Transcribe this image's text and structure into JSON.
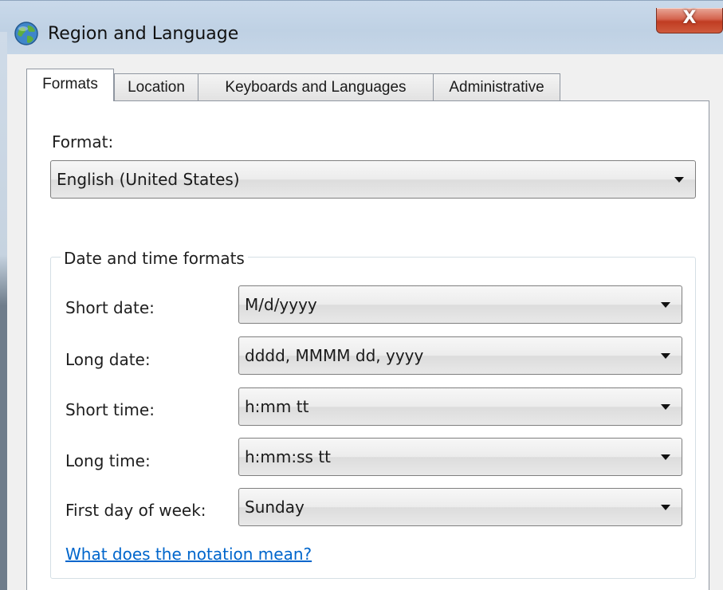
{
  "window": {
    "title": "Region and Language",
    "close_glyph": "X"
  },
  "tabs": [
    {
      "label": "Formats",
      "active": true
    },
    {
      "label": "Location",
      "active": false
    },
    {
      "label": "Keyboards and Languages",
      "active": false
    },
    {
      "label": "Administrative",
      "active": false
    }
  ],
  "format": {
    "label": "Format:",
    "value": "English (United States)"
  },
  "date_time": {
    "group_title": "Date and time formats",
    "short_date": {
      "label": "Short date:",
      "value": "M/d/yyyy"
    },
    "long_date": {
      "label": "Long date:",
      "value": "dddd, MMMM dd, yyyy"
    },
    "short_time": {
      "label": "Short time:",
      "value": "h:mm tt"
    },
    "long_time": {
      "label": "Long time:",
      "value": "h:mm:ss tt"
    },
    "first_day": {
      "label": "First day of week:",
      "value": "Sunday"
    }
  },
  "notation_link": "What does the notation mean?",
  "colors": {
    "accent_link": "#0066cc",
    "close_button": "#c03c22",
    "titlebar": "#c9d9ea"
  },
  "icons": {
    "app": "globe-icon",
    "close": "close-icon",
    "dropdown": "chevron-down-icon"
  }
}
